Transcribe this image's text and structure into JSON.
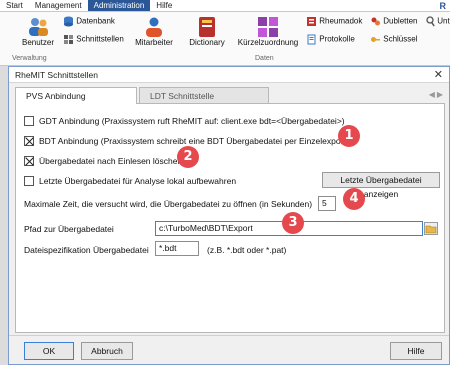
{
  "menubar": {
    "items": [
      "Start",
      "Management",
      "Administration",
      "Hilfe"
    ],
    "active_index": 2,
    "right_label": "R"
  },
  "ribbon": {
    "benutzer": "Benutzer",
    "verwaltung": "Verwaltung",
    "datenbank": "Datenbank",
    "schnittstellen": "Schnittstellen",
    "mitarbeiter": "Mitarbeiter",
    "dictionary": "Dictionary",
    "kuerzelzuordnung": "Kürzelzuordnung",
    "daten": "Daten",
    "rheumadok": "Rheumadok",
    "protokolle": "Protokolle",
    "dubletten": "Dubletten",
    "schluessel": "Schlüssel",
    "unt": "Unt"
  },
  "dialog": {
    "title": "RheMIT Schnittstellen",
    "close_glyph": "✕",
    "tabs": [
      "PVS Anbindung",
      "LDT Schnittstelle"
    ],
    "active_tab": 0
  },
  "options": {
    "gdt": {
      "label": "GDT Anbindung (Praxissystem ruft RheMIT auf: client.exe bdt=<Übergabedatei>)",
      "checked": false
    },
    "bdt": {
      "label": "BDT Anbindung (Praxissystem schreibt eine BDT Übergabedatei per Einzelexport)",
      "checked": true
    },
    "delete_after_read": {
      "label": "Übergabedatei nach Einlesen löschen",
      "checked": true
    },
    "keep_last": {
      "label": "Letzte Übergabedatei für Analyse lokal aufbewahren",
      "checked": false
    }
  },
  "show_last_button": "Letzte Übergabedatei anzeigen",
  "max_time": {
    "label": "Maximale Zeit, die versucht wird, die Übergabedatei zu öffnen (in Sekunden)",
    "value": "5"
  },
  "path": {
    "label": "Pfad zur Übergabedatei",
    "value": "c:\\TurboMed\\BDT\\Export"
  },
  "filespec": {
    "label": "Dateispezifikation Übergabedatei",
    "value": "*.bdt",
    "hint": "(z.B. *.bdt oder *.pat)"
  },
  "badges": [
    "1",
    "2",
    "3",
    "4"
  ],
  "footer": {
    "ok": "OK",
    "cancel": "Abbruch",
    "help": "Hilfe"
  },
  "colors": {
    "accent": "#2b5797",
    "badge": "#e5484d",
    "focus": "#3c7fd6"
  }
}
